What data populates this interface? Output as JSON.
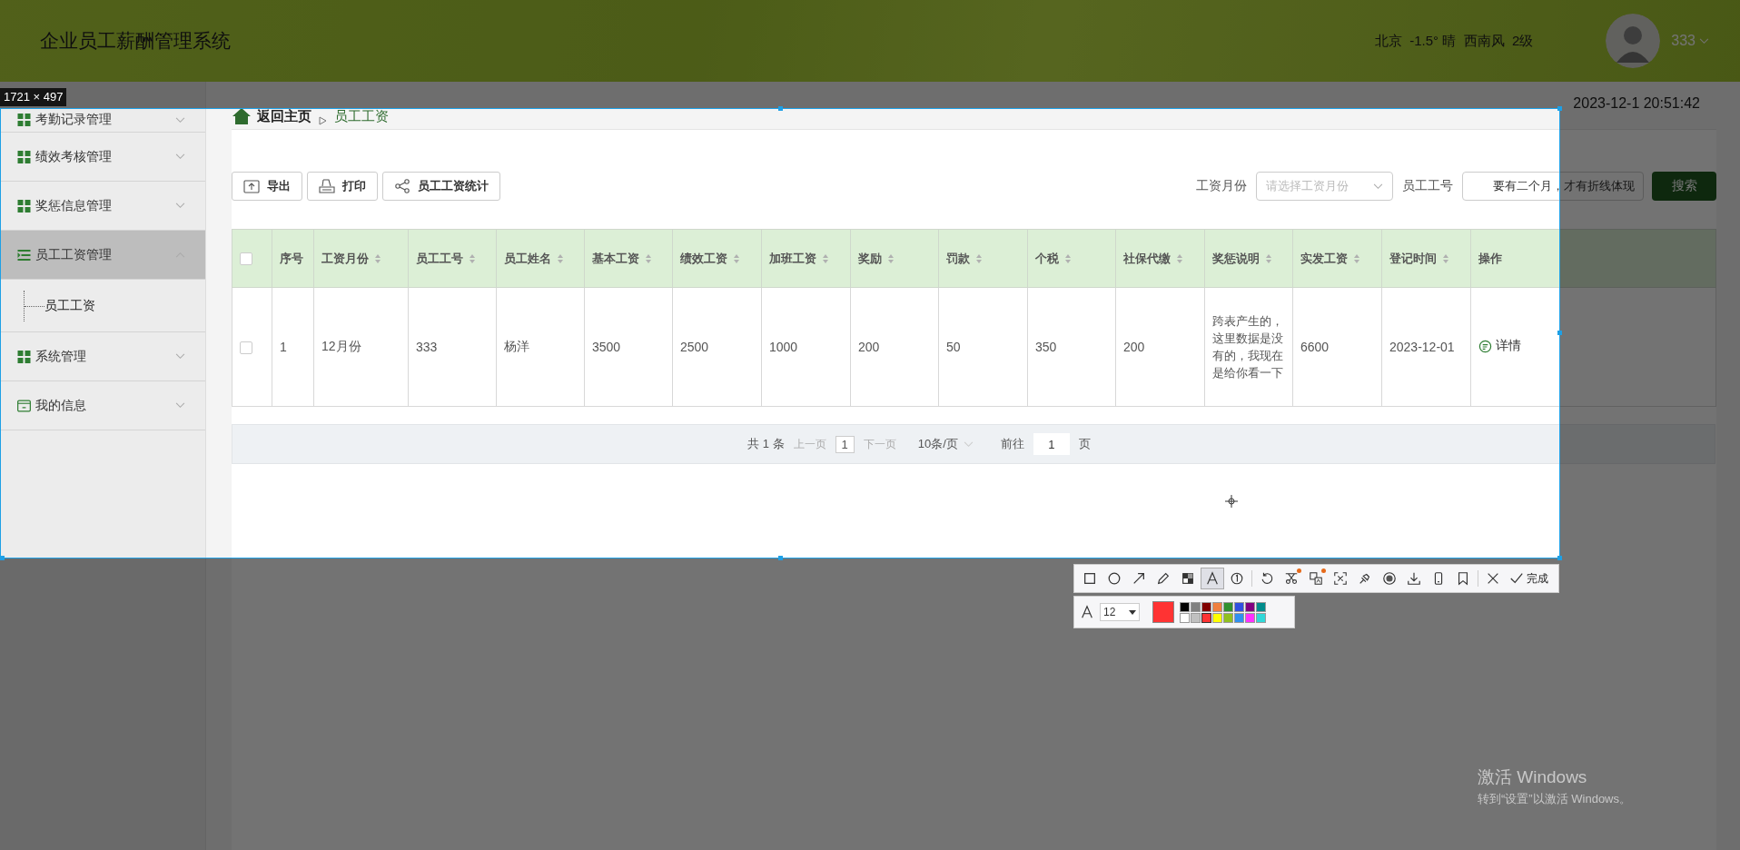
{
  "header": {
    "title": "企业员工薪酬管理系统",
    "weather": "北京  -1.5° 晴  西南风  2级",
    "user": "333"
  },
  "sidebar": {
    "items": [
      {
        "label": "考勤记录管理",
        "kind": "grid",
        "expanded": false,
        "selected": false
      },
      {
        "label": "绩效考核管理",
        "kind": "grid",
        "expanded": false,
        "selected": false
      },
      {
        "label": "奖惩信息管理",
        "kind": "grid",
        "expanded": false,
        "selected": false
      },
      {
        "label": "员工工资管理",
        "kind": "list",
        "expanded": true,
        "selected": true,
        "children": [
          {
            "label": "员工工资"
          }
        ]
      },
      {
        "label": "系统管理",
        "kind": "grid",
        "expanded": false,
        "selected": false
      },
      {
        "label": "我的信息",
        "kind": "wallet",
        "expanded": false,
        "selected": false
      }
    ]
  },
  "breadcrumb": {
    "home": "返回主页",
    "current": "员工工资"
  },
  "datetime": "2023-12-1 20:51:42",
  "toolbar": [
    {
      "label": "导出",
      "kind": "export"
    },
    {
      "label": "打印",
      "kind": "print"
    },
    {
      "label": "员工工资统计",
      "kind": "share"
    }
  ],
  "filters": {
    "month_label": "工资月份",
    "month_placeholder": "请选择工资月份",
    "id_label": "员工工号",
    "id_value": "要有二个月，才有折线体现",
    "search": "搜索"
  },
  "table": {
    "columns": [
      {
        "label": "序号",
        "sortable": false
      },
      {
        "label": "工资月份",
        "sortable": true
      },
      {
        "label": "员工工号",
        "sortable": true
      },
      {
        "label": "员工姓名",
        "sortable": true
      },
      {
        "label": "基本工资",
        "sortable": true
      },
      {
        "label": "绩效工资",
        "sortable": true
      },
      {
        "label": "加班工资",
        "sortable": true
      },
      {
        "label": "奖励",
        "sortable": true
      },
      {
        "label": "罚款",
        "sortable": true
      },
      {
        "label": "个税",
        "sortable": true
      },
      {
        "label": "社保代缴",
        "sortable": true
      },
      {
        "label": "奖惩说明",
        "sortable": true
      },
      {
        "label": "实发工资",
        "sortable": true
      },
      {
        "label": "登记时间",
        "sortable": true
      },
      {
        "label": "操作",
        "sortable": false
      }
    ],
    "all_selected": false,
    "rows": [
      {
        "selected": false,
        "cells": [
          "1",
          "12月份",
          "333",
          "杨洋",
          "3500",
          "2500",
          "1000",
          "200",
          "50",
          "350",
          "200",
          "跨表产生的，这里数据是没有的，我现在是给你看一下",
          "6600",
          "2023-12-01"
        ],
        "action": "详情"
      }
    ]
  },
  "pagination": {
    "total": "共 1 条",
    "prev": {
      "label": "上一页",
      "disabled": true
    },
    "page": "1",
    "next": {
      "label": "下一页",
      "disabled": true
    },
    "page_size": "10条/页",
    "goto": "前往",
    "goto_value": "1",
    "page_unit": "页"
  },
  "capture": {
    "size": "1721 × 497",
    "tools": [
      {
        "kind": "rect",
        "selected": false,
        "badge": false
      },
      {
        "kind": "ellipse",
        "selected": false,
        "badge": false
      },
      {
        "kind": "arrow",
        "selected": false,
        "badge": false
      },
      {
        "kind": "pencil",
        "selected": false,
        "badge": false
      },
      {
        "kind": "mosaic",
        "selected": false,
        "badge": false
      },
      {
        "kind": "text",
        "selected": true,
        "badge": false
      },
      {
        "kind": "number",
        "selected": false,
        "badge": false
      },
      {
        "kind": "undo",
        "selected": false,
        "badge": false
      },
      {
        "kind": "cut",
        "selected": false,
        "badge": true
      },
      {
        "kind": "translate",
        "selected": false,
        "badge": true
      },
      {
        "kind": "ocr",
        "selected": false,
        "badge": false
      },
      {
        "kind": "pin",
        "selected": false,
        "badge": false
      },
      {
        "kind": "record",
        "selected": false,
        "badge": false
      },
      {
        "kind": "download",
        "selected": false,
        "badge": false
      },
      {
        "kind": "phone",
        "selected": false,
        "badge": false
      },
      {
        "kind": "bookmark",
        "selected": false,
        "badge": false
      },
      {
        "kind": "close",
        "selected": false,
        "badge": false
      }
    ],
    "done": "完成",
    "font_size": "12",
    "palette": [
      {
        "color": "#000000",
        "selected": false
      },
      {
        "color": "#808080",
        "selected": false
      },
      {
        "color": "#800000",
        "selected": false
      },
      {
        "color": "#f08040",
        "selected": false
      },
      {
        "color": "#309030",
        "selected": false
      },
      {
        "color": "#3050e0",
        "selected": false
      },
      {
        "color": "#800080",
        "selected": false
      },
      {
        "color": "#008b8b",
        "selected": false
      },
      {
        "color": "#ffffff",
        "selected": false
      },
      {
        "color": "#c0c0c0",
        "selected": false
      },
      {
        "color": "#ff3333",
        "selected": true
      },
      {
        "color": "#ffff00",
        "selected": false
      },
      {
        "color": "#90c020",
        "selected": false
      },
      {
        "color": "#3090f0",
        "selected": false
      },
      {
        "color": "#ff30ff",
        "selected": false
      },
      {
        "color": "#30d8d8",
        "selected": false
      }
    ]
  },
  "os_notice": {
    "title": "激活 Windows",
    "text": "转到“设置”以激活 Windows。"
  }
}
